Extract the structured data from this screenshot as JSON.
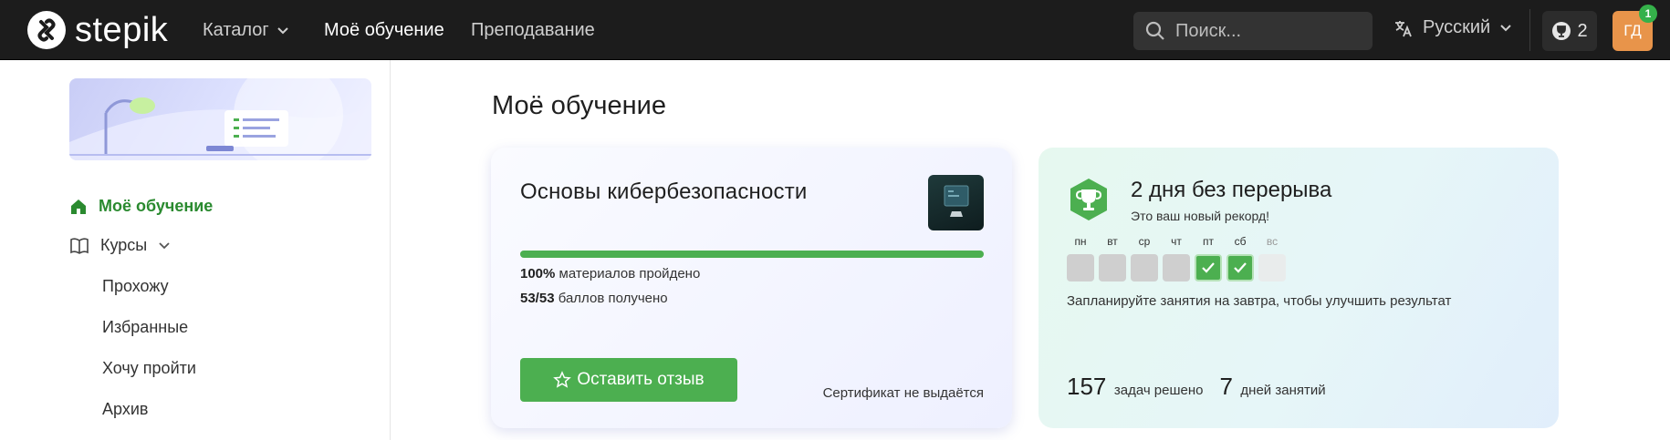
{
  "header": {
    "logo_text": "stepik",
    "nav": {
      "catalog": "Каталог",
      "learning": "Моё обучение",
      "teaching": "Преподавание"
    },
    "search_placeholder": "Поиск...",
    "language": "Русский",
    "trophies": "2",
    "avatar_initials": "ГД",
    "notifications": "1"
  },
  "sidebar": {
    "items": {
      "learning": "Моё обучение",
      "courses": "Курсы",
      "passing": "Прохожу",
      "favorites": "Избранные",
      "want": "Хочу пройти",
      "archive": "Архив"
    }
  },
  "main": {
    "title": "Моё обучение",
    "course": {
      "title": "Основы кибербезопасности",
      "progress_percent": 100,
      "progress_value": "100%",
      "progress_label": "материалов пройдено",
      "points_value": "53/53",
      "points_label": "баллов получено",
      "review_button": "Оставить отзыв",
      "certificate_note": "Сертификат не выдаётся"
    },
    "streak": {
      "title": "2 дня без перерыва",
      "subtitle": "Это ваш новый рекорд!",
      "days": [
        {
          "label": "пн",
          "state": "missed"
        },
        {
          "label": "вт",
          "state": "missed"
        },
        {
          "label": "ср",
          "state": "missed"
        },
        {
          "label": "чт",
          "state": "missed"
        },
        {
          "label": "пт",
          "state": "done"
        },
        {
          "label": "сб",
          "state": "done"
        },
        {
          "label": "вс",
          "state": "future"
        }
      ],
      "plan_text": "Запланируйте занятия на завтра, чтобы улучшить результат",
      "solved_count": "157",
      "solved_label": "задач решено",
      "days_count": "7",
      "days_label": "дней занятий"
    }
  },
  "colors": {
    "accent_green": "#4caf50",
    "topbar": "#1c1c1c",
    "avatar": "#e8944a"
  }
}
